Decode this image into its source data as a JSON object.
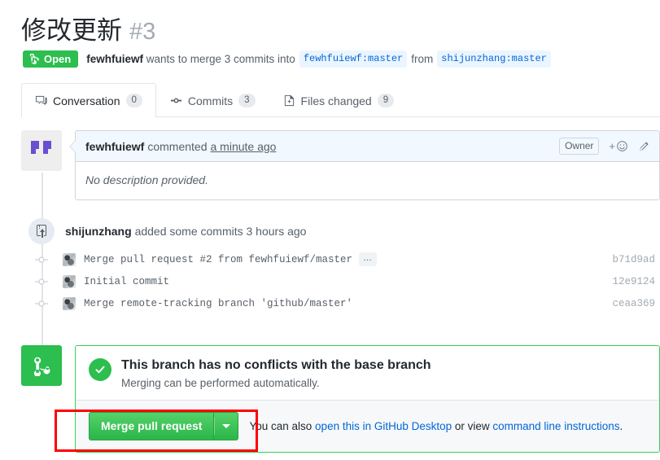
{
  "header": {
    "title": "修改更新",
    "number": "#3",
    "state": "Open",
    "state_icon": "git-pull-request-icon",
    "state_color": "#2cbe4e",
    "author": "fewhfuiewf",
    "action_text_before": "wants to merge 3 commits into",
    "base_branch": "fewhfuiewf:master",
    "from_word": "from",
    "head_branch": "shijunzhang:master"
  },
  "tabs": [
    {
      "label": "Conversation",
      "count": "0",
      "icon": "comment-discussion-icon",
      "active": true
    },
    {
      "label": "Commits",
      "count": "3",
      "icon": "git-commit-icon",
      "active": false
    },
    {
      "label": "Files changed",
      "count": "9",
      "icon": "diff-icon",
      "active": false
    }
  ],
  "comment": {
    "avatar_icon": "user-identicon-avatar",
    "author": "fewhfuiewf",
    "action": "commented",
    "time": "a minute ago",
    "owner_badge": "Owner",
    "react_icon": "add-reaction-icon",
    "edit_icon": "pencil-icon",
    "body": "No description provided."
  },
  "commits_event": {
    "icon": "repo-push-icon",
    "author": "shijunzhang",
    "text": "added some commits 3 hours ago",
    "commits": [
      {
        "message": "Merge pull request #2 from fewhfuiewf/master",
        "sha": "b71d9ad",
        "has_ellipsis": true,
        "ellipsis_label": "…"
      },
      {
        "message": "Initial commit",
        "sha": "12e9124",
        "has_ellipsis": false,
        "ellipsis_label": ""
      },
      {
        "message": "Merge remote-tracking branch 'github/master'",
        "sha": "ceaa369",
        "has_ellipsis": false,
        "ellipsis_label": ""
      }
    ]
  },
  "merge": {
    "icon": "git-merge-icon",
    "icon_bg": "#2cbe4e",
    "check_icon": "check-icon",
    "status_title": "This branch has no conflicts with the base branch",
    "status_sub": "Merging can be performed automatically.",
    "button_label": "Merge pull request",
    "dropdown_icon": "chevron-down-icon",
    "note_prefix": "You can also ",
    "note_link1": "open this in GitHub Desktop",
    "note_middle": " or view ",
    "note_link2": "command line instructions",
    "note_suffix": "."
  },
  "annotation": {
    "color": "#fe0000",
    "target": "merge-pull-request-button"
  }
}
